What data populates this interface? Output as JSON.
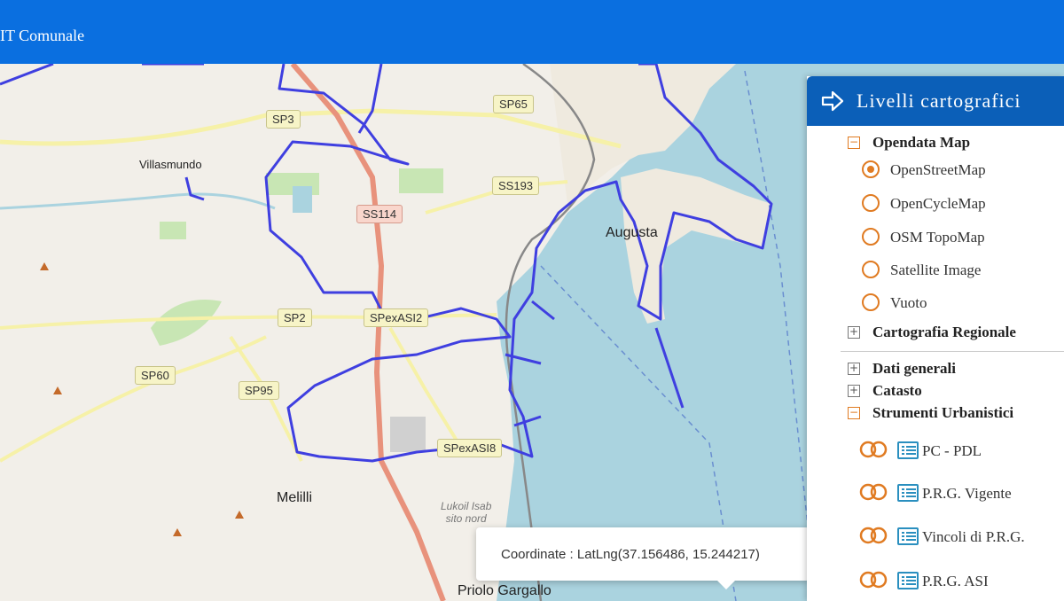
{
  "header": {
    "title": "IT Comunale"
  },
  "map": {
    "road_labels": [
      "SP3",
      "SP65",
      "SS193",
      "SS114",
      "SP2",
      "SPexASI2",
      "SP60",
      "SP95",
      "SPexASI8"
    ],
    "towns": [
      "Villasmundo",
      "Augusta",
      "Melilli",
      "Priolo Gargallo"
    ],
    "poi": [
      "Lukoil Isab",
      "sito nord"
    ],
    "popup": {
      "text": "Coordinate : LatLng(37.156486, 15.244217)"
    },
    "colors": {
      "sea": "#aad3df",
      "land": "#f2efe9",
      "boundary": "#3f3fe0",
      "motorway": "#e8927c",
      "primary": "#f6f1a8"
    }
  },
  "panel": {
    "title": "Livelli cartografici",
    "opendata": {
      "label": "Opendata Map",
      "options": [
        "OpenStreetMap",
        "OpenCycleMap",
        "OSM TopoMap",
        "Satellite Image",
        "Vuoto"
      ],
      "selected": "OpenStreetMap"
    },
    "groups": [
      "Cartografia Regionale",
      "Dati generali",
      "Catasto",
      "Strumenti Urbanistici"
    ],
    "layers": [
      "PC - PDL",
      "P.R.G. Vigente",
      "Vincoli di P.R.G.",
      "P.R.G. ASI"
    ],
    "icons": [
      "arrow-right-icon",
      "collapse-icon",
      "expand-icon",
      "radio-icon",
      "toggle-icon",
      "list-icon"
    ],
    "accent": "#e07b22"
  }
}
